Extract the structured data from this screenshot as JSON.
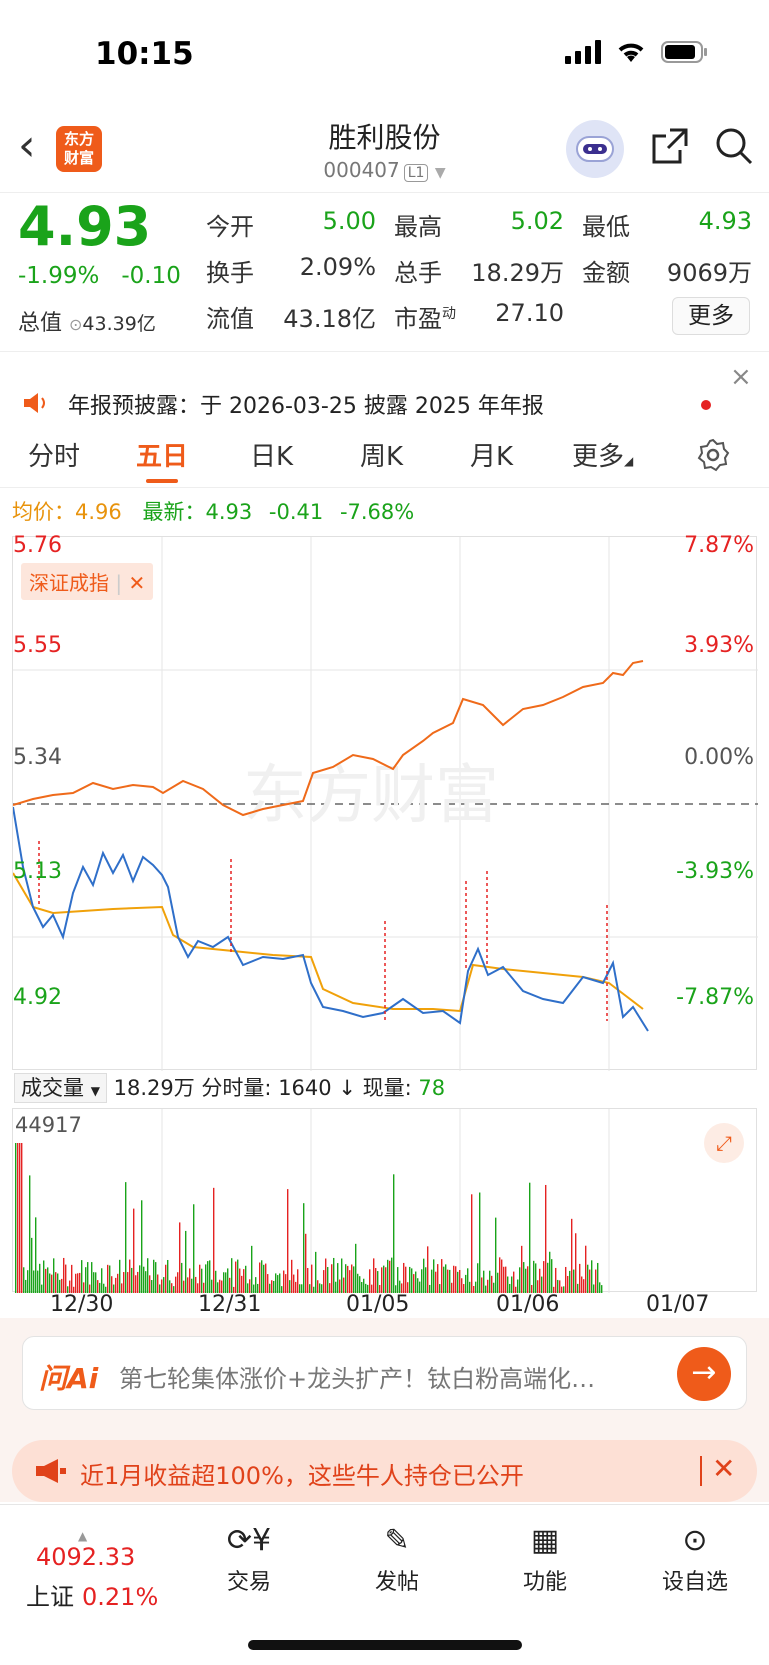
{
  "status_bar": {
    "time": "10:15"
  },
  "header": {
    "title": "胜利股份",
    "code": "000407",
    "level_tag": "L1",
    "logo_text_1": "东方",
    "logo_text_2": "财富"
  },
  "quote": {
    "price": "4.93",
    "change_pct": "-1.99%",
    "change": "-0.10",
    "total_cap_label": "总值",
    "total_cap": "43.39亿",
    "open_label": "今开",
    "open": "5.00",
    "high_label": "最高",
    "high": "5.02",
    "low_label": "最低",
    "low": "4.93",
    "turnover_label": "换手",
    "turnover": "2.09%",
    "volume_label": "总手",
    "volume": "18.29万",
    "amount_label": "金额",
    "amount": "9069万",
    "float_cap_label": "流值",
    "float_cap": "43.18亿",
    "pe_label": "市盈",
    "pe_sup": "动",
    "pe": "27.10",
    "more_button": "更多"
  },
  "notice": {
    "text": "年报预披露：于 2026-03-25 披露 2025 年年报"
  },
  "tabs": [
    "分时",
    "五日",
    "日K",
    "周K",
    "月K",
    "更多"
  ],
  "active_tab": "五日",
  "avg_info": {
    "avg_label": "均价：",
    "avg": "4.96",
    "latest_label": "最新：",
    "latest": "4.93",
    "change": "-0.41",
    "change_pct": "-7.68%"
  },
  "chart": {
    "index_tag": "深证成指",
    "y_left": [
      "5.76",
      "5.55",
      "5.34",
      "5.13",
      "4.92"
    ],
    "y_right": [
      "7.87%",
      "3.93%",
      "0.00%",
      "-3.93%",
      "-7.87%"
    ],
    "watermark": "东方财富"
  },
  "volume_bar": {
    "selector": "成交量",
    "total": "18.29万",
    "tick_label": "分时量:",
    "tick": "1640",
    "arrow": "↓",
    "now_label": "现量:",
    "now": "78",
    "max_label": "44917"
  },
  "x_axis": [
    "12/30",
    "12/31",
    "01/05",
    "01/06",
    "01/07"
  ],
  "ai_box": {
    "logo": "问Ai",
    "text": "第七轮集体涨价+龙头扩产！钛白粉高端化…"
  },
  "promo": {
    "text": "近1月收益超100%，这些牛人持仓已公开"
  },
  "bottom_bar": {
    "index_value": "4092.33",
    "index_name": "上证",
    "index_change": "0.21%",
    "nav": [
      "交易",
      "发帖",
      "功能",
      "设自选"
    ]
  },
  "chart_data": {
    "type": "line",
    "x": [
      "12/30",
      "12/31",
      "01/05",
      "01/06",
      "01/07"
    ],
    "ylim": [
      4.92,
      5.76
    ],
    "series": [
      {
        "name": "深证成指",
        "color": "#ef6a1a"
      }
    ]
  },
  "colors": {
    "accent": "#ef5b1a",
    "up": "#e52222",
    "down": "#1aa31a",
    "price_line": "#2f6fc9",
    "avg_line": "#f0a10a"
  }
}
